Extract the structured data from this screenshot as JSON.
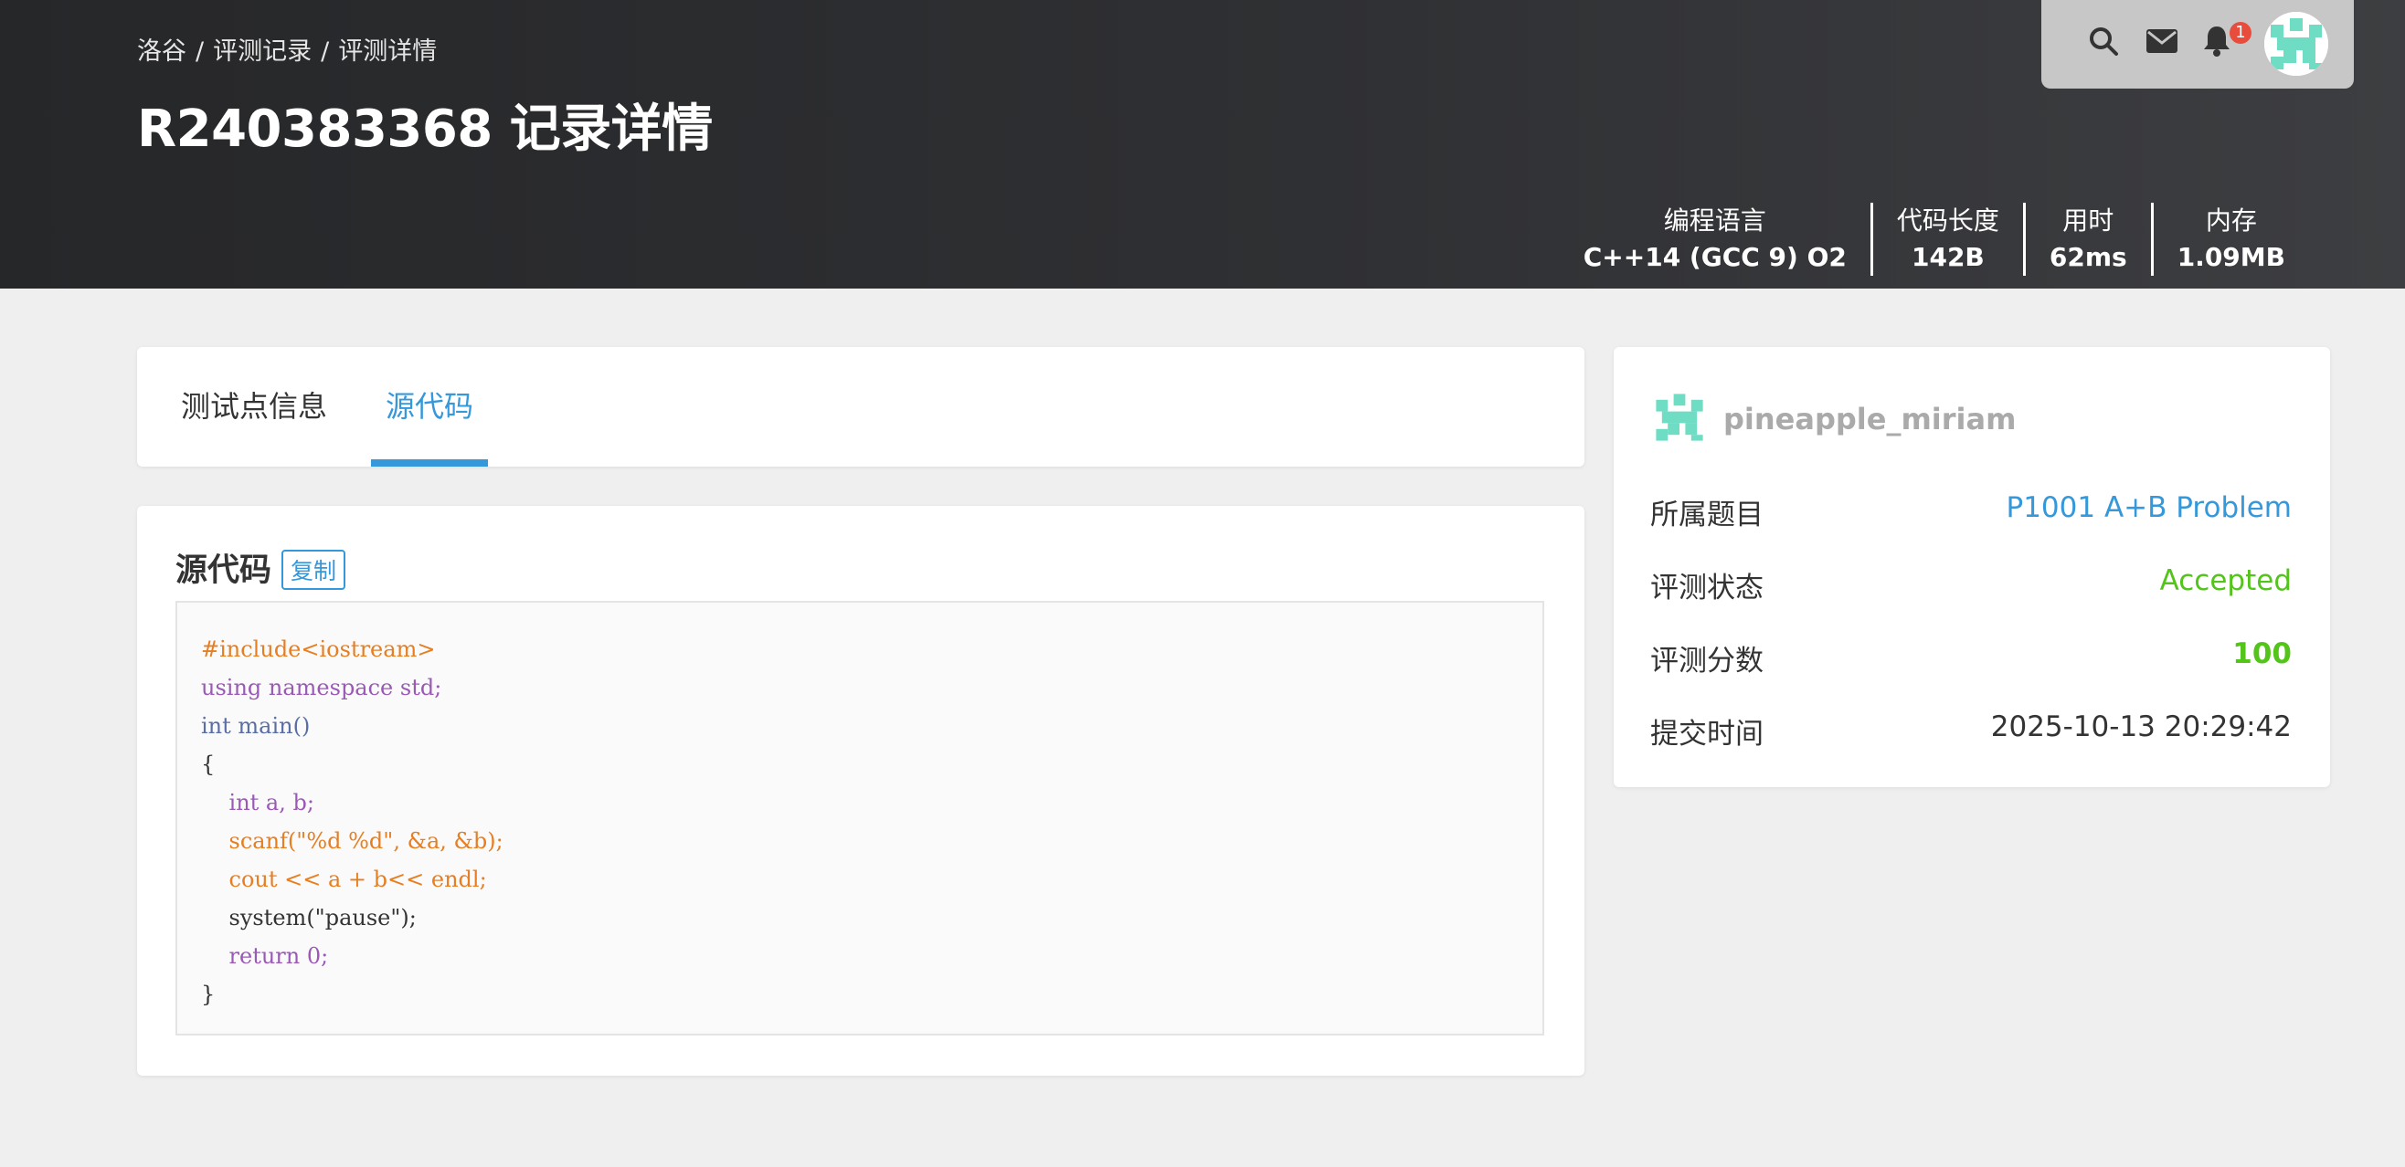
{
  "header": {
    "breadcrumb": [
      "洛谷",
      "评测记录",
      "评测详情"
    ],
    "breadcrumb_sep": "/",
    "title": "R240383368 记录详情",
    "notification_count": "1",
    "stats": [
      {
        "label": "编程语言",
        "value": "C++14 (GCC 9) O2"
      },
      {
        "label": "代码长度",
        "value": "142B"
      },
      {
        "label": "用时",
        "value": "62ms"
      },
      {
        "label": "内存",
        "value": "1.09MB"
      }
    ]
  },
  "tabs": [
    {
      "label": "测试点信息",
      "active": false
    },
    {
      "label": "源代码",
      "active": true
    }
  ],
  "source": {
    "title": "源代码",
    "copy_label": "复制",
    "code_lines": [
      "#include<iostream>",
      "using namespace std;",
      "int main()",
      "{",
      "    int a, b;",
      "    scanf(\"%d %d\", &a, &b);",
      "    cout << a + b<< endl;",
      "    system(\"pause\");",
      "    return 0;",
      "}"
    ]
  },
  "record": {
    "username": "pineapple_miriam",
    "rows": [
      {
        "label": "所属题目",
        "value": "P1001 A+B Problem"
      },
      {
        "label": "评测状态",
        "value": "Accepted"
      },
      {
        "label": "评测分数",
        "value": "100"
      },
      {
        "label": "提交时间",
        "value": "2025-10-13 20:29:42"
      }
    ]
  },
  "colors": {
    "accent": "#3498db",
    "accepted": "#52c41a",
    "badge": "#e74c3c",
    "avatar": "#6fdcc4"
  },
  "icons": [
    "search-icon",
    "mail-icon",
    "bell-icon"
  ]
}
